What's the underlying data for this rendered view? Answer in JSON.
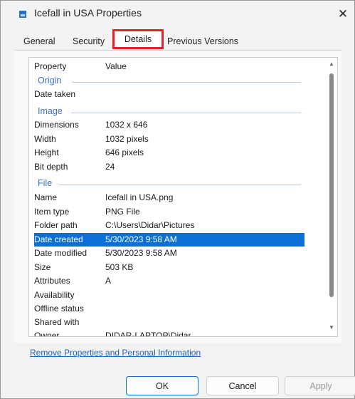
{
  "window": {
    "title": "Icefall in USA Properties",
    "close_glyph": "✕",
    "accent_color": "#0c6fd6",
    "highlight_color": "#e8202a"
  },
  "tabs": {
    "general": "General",
    "security": "Security",
    "details": "Details",
    "previous_versions": "Previous Versions",
    "active": "Details"
  },
  "list": {
    "header_property": "Property",
    "header_value": "Value",
    "groups": {
      "origin": "Origin",
      "image": "Image",
      "file": "File"
    },
    "rows": {
      "date_taken": {
        "property": "Date taken",
        "value": ""
      },
      "dimensions": {
        "property": "Dimensions",
        "value": "1032 x 646"
      },
      "width": {
        "property": "Width",
        "value": "1032 pixels"
      },
      "height": {
        "property": "Height",
        "value": "646 pixels"
      },
      "bit_depth": {
        "property": "Bit depth",
        "value": "24"
      },
      "name": {
        "property": "Name",
        "value": "Icefall in USA.png"
      },
      "item_type": {
        "property": "Item type",
        "value": "PNG File"
      },
      "folder_path": {
        "property": "Folder path",
        "value": "C:\\Users\\Didar\\Pictures"
      },
      "date_created": {
        "property": "Date created",
        "value": "5/30/2023 9:58 AM",
        "selected": true
      },
      "date_modified": {
        "property": "Date modified",
        "value": "5/30/2023 9:58 AM"
      },
      "size": {
        "property": "Size",
        "value": "503 KB"
      },
      "attributes": {
        "property": "Attributes",
        "value": "A"
      },
      "availability": {
        "property": "Availability",
        "value": ""
      },
      "offline_status": {
        "property": "Offline status",
        "value": ""
      },
      "shared_with": {
        "property": "Shared with",
        "value": ""
      },
      "owner": {
        "property": "Owner",
        "value": "DIDAR-LAPTOP\\Didar"
      }
    }
  },
  "footer": {
    "remove_link": "Remove Properties and Personal Information"
  },
  "buttons": {
    "ok": "OK",
    "cancel": "Cancel",
    "apply": "Apply"
  },
  "icons": {
    "title_icon": "image-file-icon",
    "scroll_up": "▲",
    "scroll_down": "▼"
  }
}
